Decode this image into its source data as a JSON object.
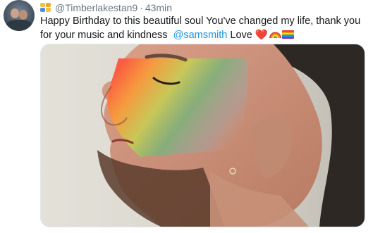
{
  "tweet": {
    "handle": "@Timberlakestan9",
    "separator": "·",
    "time": "43min",
    "text_before": "Happy Birthday to this beautiful soul You've changed my life, thank you for your music and kindness",
    "mention": "@samsmith",
    "text_after": "Love",
    "heart": "❤️"
  },
  "icons": {
    "avatar": "profile-avatar",
    "badge": "people-hugging-emoji",
    "heart": "red-heart-emoji",
    "rainbow": "rainbow-emoji",
    "flag": "rainbow-flag-emoji"
  },
  "colors": {
    "mention": "#1b95e0",
    "meta": "#657786",
    "text": "#14171a"
  }
}
